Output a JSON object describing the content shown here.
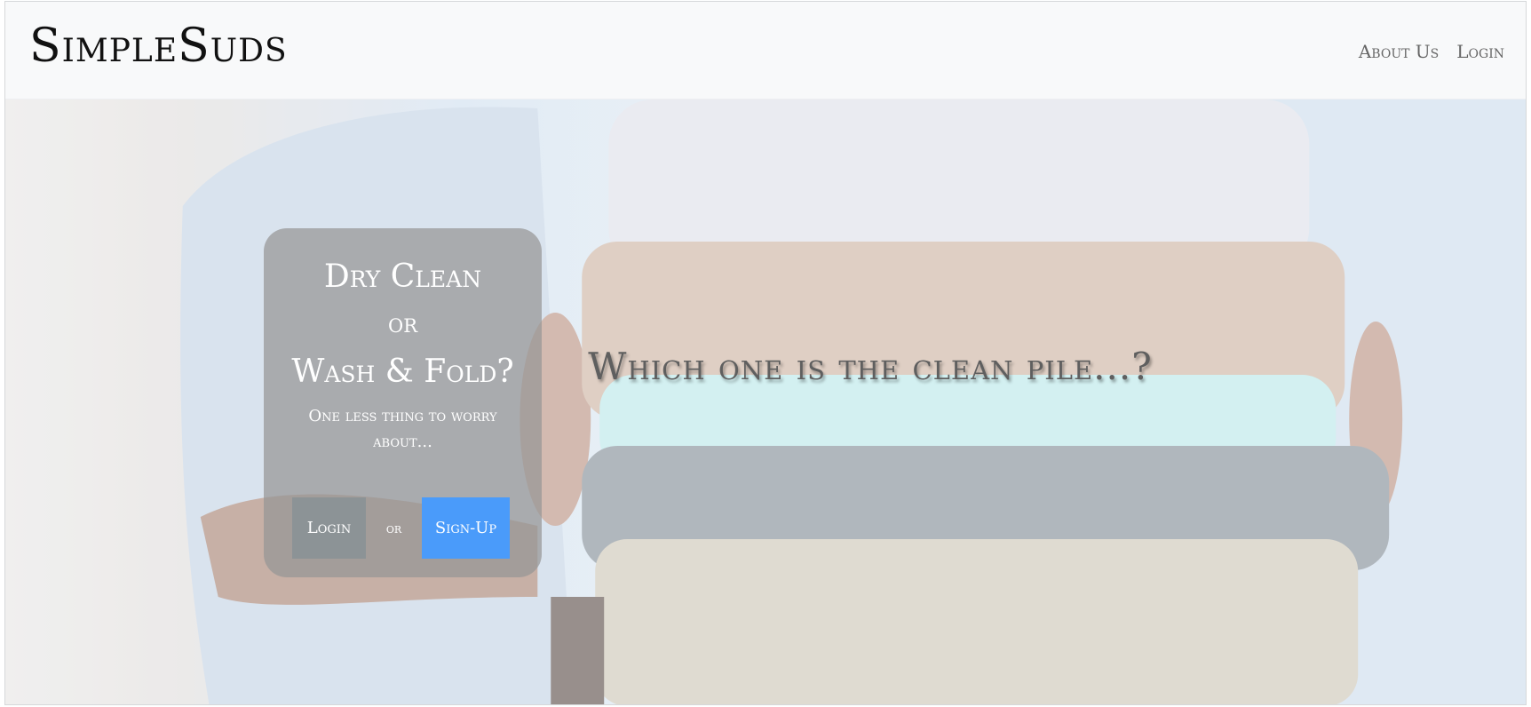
{
  "navbar": {
    "brand": "SimpleSuds",
    "links": [
      {
        "label": "About Us"
      },
      {
        "label": "Login"
      }
    ]
  },
  "hero": {
    "tagline": "Which one is the clean pile...?"
  },
  "card": {
    "title_line1": "Dry Clean",
    "title_line2": "or",
    "title_line3": "Wash & Fold?",
    "subtitle": "One less thing to worry about...",
    "login_label": "Login",
    "or_label": "or",
    "signup_label": "Sign-Up"
  },
  "colors": {
    "signup_button": "#4a9bfa",
    "login_button": "#8c9396",
    "card_background": "rgba(150,150,150,0.72)"
  }
}
